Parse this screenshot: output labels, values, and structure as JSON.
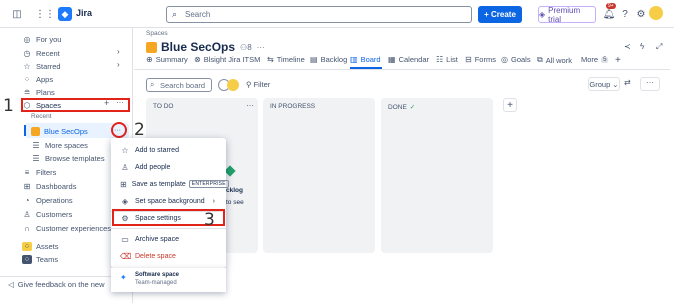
{
  "topbar": {
    "app_name": "Jira",
    "search_placeholder": "Search",
    "create_label": "+ Create",
    "premium_label": "Premium trial",
    "notif_count": "9+"
  },
  "sidebar": {
    "items": [
      {
        "label": "For you"
      },
      {
        "label": "Recent"
      },
      {
        "label": "Starred"
      },
      {
        "label": "Apps"
      },
      {
        "label": "Plans"
      },
      {
        "label": "Spaces"
      }
    ],
    "recent_label": "Recent",
    "space_items": [
      {
        "label": "Blue SecOps"
      },
      {
        "label": "More spaces"
      },
      {
        "label": "Browse templates"
      }
    ],
    "lower_items": [
      {
        "label": "Filters"
      },
      {
        "label": "Dashboards"
      },
      {
        "label": "Operations"
      },
      {
        "label": "Customers"
      },
      {
        "label": "Customer experiences"
      },
      {
        "label": "Assets"
      },
      {
        "label": "Teams"
      }
    ],
    "feedback": "Give feedback on the new"
  },
  "steps": {
    "one": "1",
    "two": "2",
    "three": "3"
  },
  "main": {
    "breadcrumb": "Spaces",
    "title": "Blue SecOps",
    "title_people": "8",
    "tabs": [
      {
        "label": "Summary"
      },
      {
        "label": "Blsight Jira ITSM"
      },
      {
        "label": "Timeline"
      },
      {
        "label": "Backlog"
      },
      {
        "label": "Board"
      },
      {
        "label": "Calendar"
      },
      {
        "label": "List"
      },
      {
        "label": "Forms"
      },
      {
        "label": "Goals"
      },
      {
        "label": "All work"
      },
      {
        "label": "More"
      }
    ],
    "more_count": "5",
    "search_board": "Search board",
    "filter": "Filter",
    "group": "Group",
    "columns": [
      {
        "label": "TO DO"
      },
      {
        "label": "IN PROGRESS"
      },
      {
        "label": "DONE"
      }
    ],
    "behind_menu_text": [
      "cklog",
      "to see"
    ]
  },
  "menu": {
    "items": [
      {
        "label": "Add to starred"
      },
      {
        "label": "Add people"
      },
      {
        "label": "Save as template",
        "badge": "ENTERPRISE"
      },
      {
        "label": "Set space background"
      },
      {
        "label": "Space settings"
      },
      {
        "label": "Archive space"
      },
      {
        "label": "Delete space"
      }
    ],
    "footer_title": "Software space",
    "footer_sub": "Team-managed"
  },
  "colors": {
    "accent": "#0c66e4",
    "highlight": "#e2231a",
    "space_logo": "#f5a623"
  }
}
